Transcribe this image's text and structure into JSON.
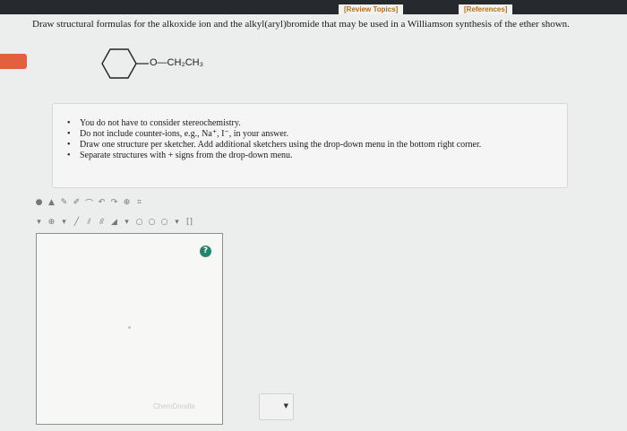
{
  "header": {
    "review_topics": "[Review Topics]",
    "references": "[References]"
  },
  "question": {
    "text": "Draw structural formulas for the alkoxide ion and the alkyl(aryl)bromide that may be used in a Williamson synthesis of the ether shown."
  },
  "molecule": {
    "substituent": "O—CH₂CH₃"
  },
  "hints": [
    "You do not have to consider stereochemistry.",
    "Do not include counter-ions, e.g., Na⁺, I⁻, in your answer.",
    "Draw one structure per sketcher. Add additional sketchers using the drop-down menu in the bottom right corner.",
    "Separate structures with + signs from the drop-down menu."
  ],
  "sketcher": {
    "help_label": "?",
    "watermark": "ChemDoodle",
    "toolbar2_text": "[]"
  },
  "colors": {
    "topbar": "#262a2e",
    "link": "#b86e1c",
    "accent_tab": "#e2603d",
    "help_button": "#23856e"
  }
}
